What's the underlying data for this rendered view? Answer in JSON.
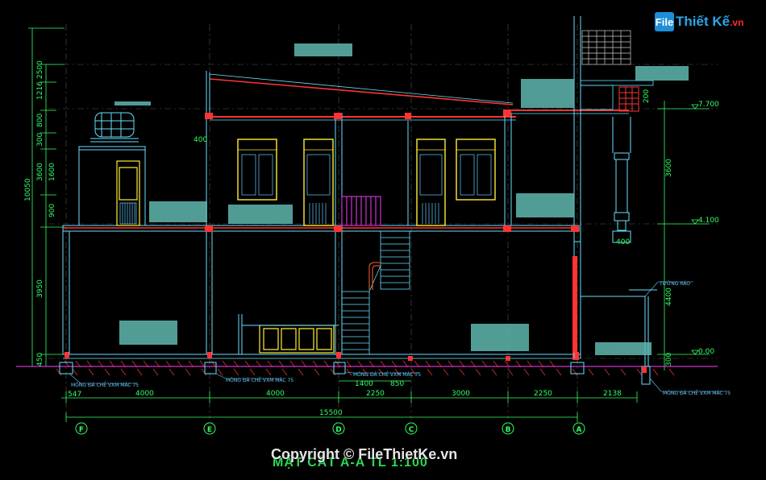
{
  "watermark": {
    "logo_mark": "File",
    "logo_text": "Thiết Kế",
    "logo_suffix": ".vn"
  },
  "copyright": "Copyright © FileThietKe.vn",
  "drawing_title": "MẶT CẮT A-A TL 1:100",
  "left_dims": [
    "2500",
    "1216",
    "800",
    "300",
    "1600",
    "3600",
    "900",
    "10050",
    "3950",
    "450"
  ],
  "right_dims": [
    "3600",
    "4400",
    "300"
  ],
  "right_box_dim": "200",
  "level_marks": [
    "7.700",
    "4.100",
    "0.00"
  ],
  "bottom_dims": [
    "547",
    "4000",
    "4000",
    "2250",
    "3000",
    "2250",
    "2138"
  ],
  "stair_dims": [
    "1400",
    "850"
  ],
  "total_dim": "15500",
  "grid_axes": [
    "F",
    "E",
    "D",
    "C",
    "B",
    "A"
  ],
  "notes": {
    "foundation_1": "MÓNG ĐÁ CHẺ VXM MÁC 75",
    "foundation_2": "MÓNG ĐÁ CHẺ VXM MÁC 75",
    "foundation_3": "MÓNG ĐÁ CHẺ VXM MÁC 75",
    "foundation_4": "MÓNG ĐÁ CHẺ VXM MÁC 75",
    "fence": "TƯỜNG RÀO",
    "beam_tag_1": "400",
    "beam_tag_2": "400"
  },
  "colors": {
    "background": "#000000",
    "dimension": "#33ff66",
    "wall": "#66e0ff",
    "slab": "#ff3333",
    "window": "#ffee33",
    "hatch": "#5fb8b0",
    "stair_rail": "#cc33cc"
  }
}
